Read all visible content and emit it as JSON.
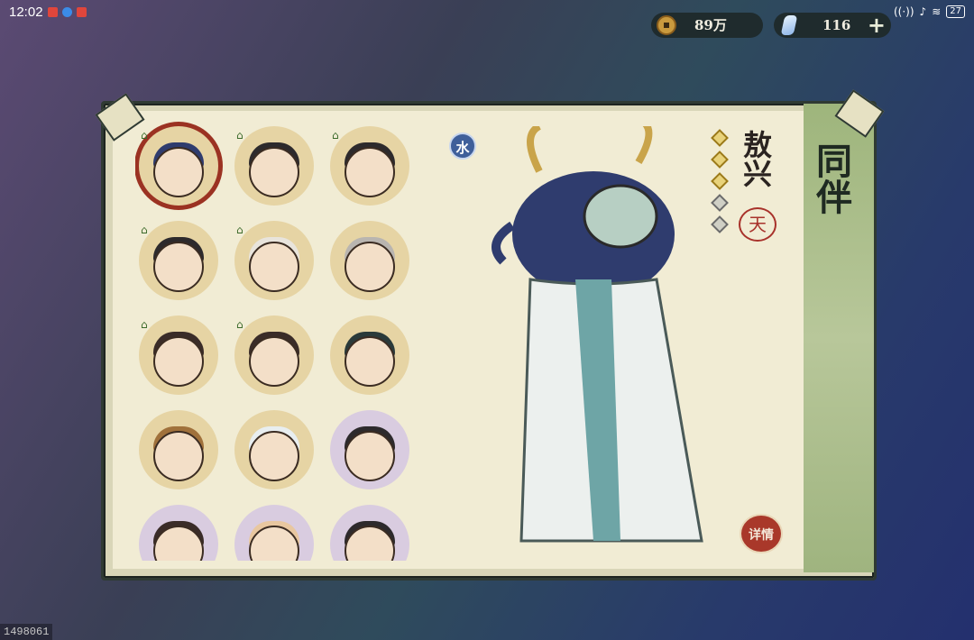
{
  "status_bar": {
    "time": "12:02",
    "battery": "27"
  },
  "currency": {
    "coins": "89万",
    "gems": "116"
  },
  "panel": {
    "title": "同伴"
  },
  "selected_companion": {
    "name": "敖兴",
    "element": "水",
    "rank": "天",
    "stars": 5,
    "stars_filled": 3
  },
  "details_label": "详情",
  "build_id": "1498061",
  "companions": [
    {
      "id": "dragon",
      "color": "sand",
      "home": true,
      "selected": true
    },
    {
      "id": "scholar",
      "color": "sand",
      "home": true
    },
    {
      "id": "lady-red",
      "color": "sand",
      "home": true
    },
    {
      "id": "boy-bun",
      "color": "sand",
      "home": true
    },
    {
      "id": "old-sage",
      "color": "sand",
      "home": true
    },
    {
      "id": "grey-hair",
      "color": "sand",
      "home": false
    },
    {
      "id": "flower-girl",
      "color": "sand",
      "home": true
    },
    {
      "id": "goddess",
      "color": "sand",
      "home": true
    },
    {
      "id": "snake",
      "color": "sand",
      "home": false
    },
    {
      "id": "deer",
      "color": "sand",
      "home": false
    },
    {
      "id": "goat",
      "color": "sand",
      "home": false
    },
    {
      "id": "child-blue",
      "color": "purple",
      "home": false
    },
    {
      "id": "girl-buns",
      "color": "purple",
      "home": false
    },
    {
      "id": "monkey",
      "color": "purple",
      "home": false
    },
    {
      "id": "official",
      "color": "purple",
      "home": false
    }
  ]
}
